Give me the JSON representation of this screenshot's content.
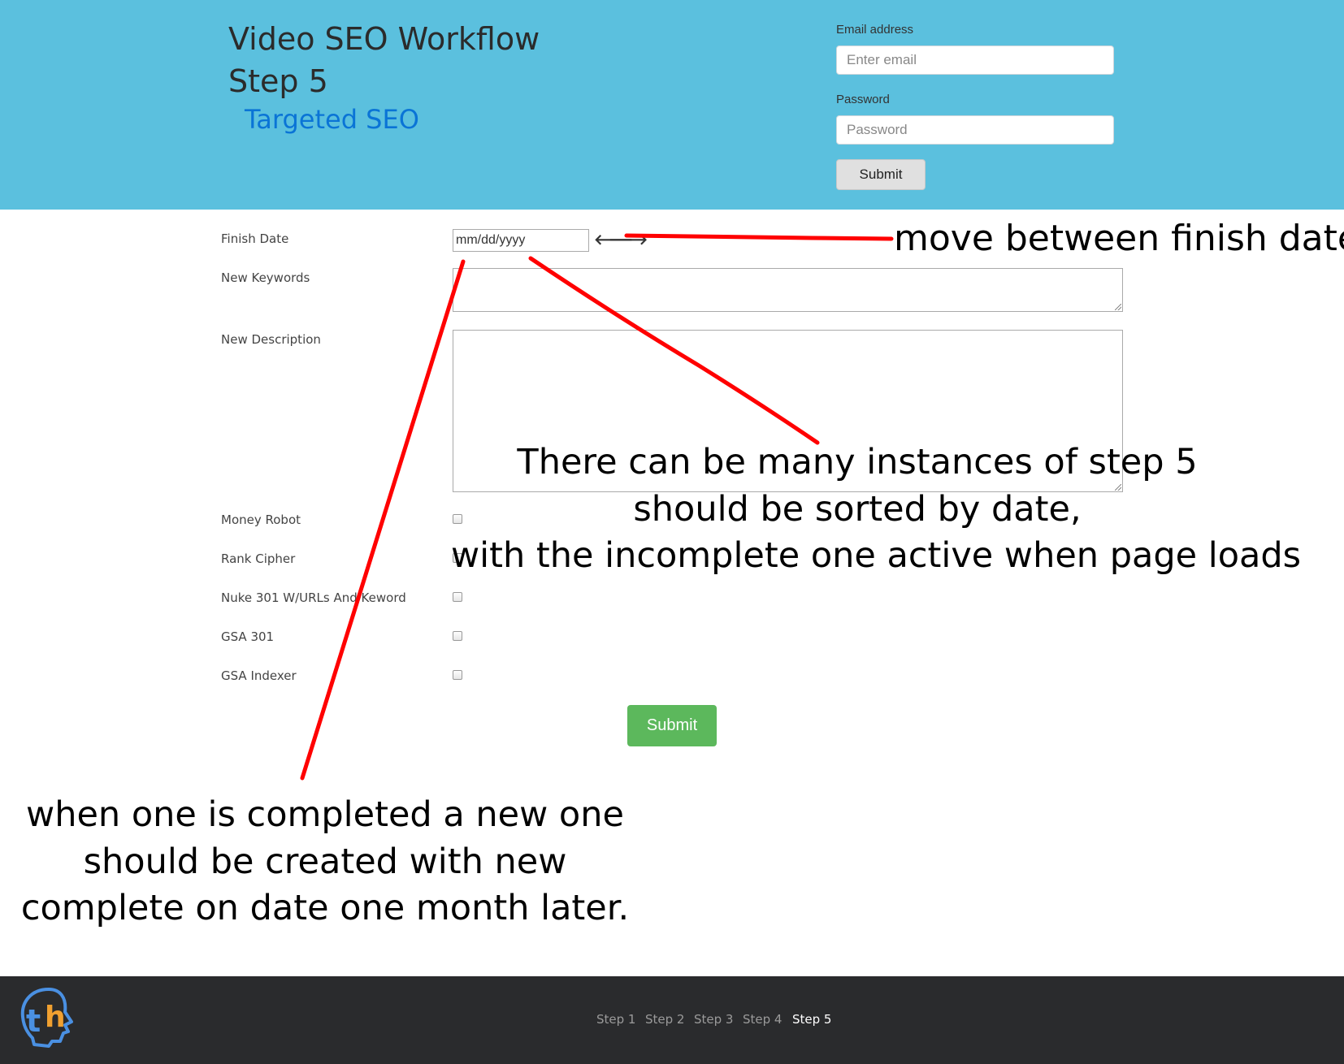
{
  "header": {
    "title_line1": "Video SEO Workflow",
    "title_line2": "Step 5",
    "subtitle": "Targeted SEO",
    "email_label": "Email address",
    "email_placeholder": "Enter email",
    "password_label": "Password",
    "password_placeholder": "Password",
    "submit_label": "Submit",
    "background_color": "#5bc0de"
  },
  "form": {
    "finish_date_label": "Finish Date",
    "finish_date_placeholder": "mm/dd/yyyy",
    "prev_arrow": "🡐",
    "next_arrow": "🡒",
    "new_keywords_label": "New Keywords",
    "new_description_label": "New Description",
    "checkboxes": [
      {
        "label": "Money Robot",
        "checked": false
      },
      {
        "label": "Rank Cipher",
        "checked": false
      },
      {
        "label": "Nuke 301 W/URLs And Keword",
        "checked": false
      },
      {
        "label": "GSA 301",
        "checked": false
      },
      {
        "label": "GSA Indexer",
        "checked": false
      }
    ],
    "submit_label": "Submit",
    "submit_color": "#5cb85c"
  },
  "annotations": {
    "move_dates": "move between finish dates",
    "instances_line1": "There can be many instances of step 5",
    "instances_line2": "should be sorted by date,",
    "instances_line3": "with the incomplete one active when page loads",
    "completed_line1": "when one is completed a new one",
    "completed_line2": "should be created with new",
    "completed_line3": "complete on date one month later.",
    "line_color": "#ff0000"
  },
  "footer": {
    "logo_text": "th",
    "steps": [
      "Step 1",
      "Step 2",
      "Step 3",
      "Step 4",
      "Step 5"
    ],
    "active_step": "Step 5",
    "background_color": "#2a2b2d"
  }
}
